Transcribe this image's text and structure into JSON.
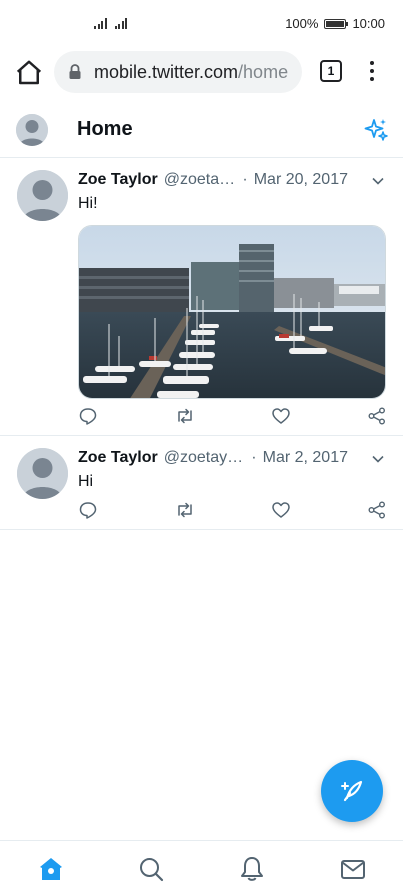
{
  "status_bar": {
    "battery": "100%",
    "time": "10:00"
  },
  "browser": {
    "url_host": "mobile.twitter.com",
    "url_path": "/home",
    "tab_count": "1"
  },
  "header": {
    "title": "Home"
  },
  "tweets": [
    {
      "name": "Zoe Taylor",
      "handle": "@zoetaylo...",
      "separator": "·",
      "date": "Mar 20, 2017",
      "text": "Hi!",
      "has_media": true
    },
    {
      "name": "Zoe Taylor",
      "handle": "@zoetaylor...",
      "separator": "·",
      "date": "Mar 2, 2017",
      "text": "Hi",
      "has_media": false
    }
  ],
  "colors": {
    "accent": "#1d9bf0",
    "text": "#0f1419",
    "secondary_text": "#536471",
    "divider": "#e6ecf0"
  },
  "icons": {
    "browser": [
      "home-icon",
      "lock-icon",
      "tabs-icon",
      "more-vert-icon"
    ],
    "header": [
      "sparkle-icon"
    ],
    "tweet_actions": [
      "reply-icon",
      "retweet-icon",
      "like-icon",
      "share-icon"
    ],
    "fab": "compose-tweet-icon",
    "bottom_nav": [
      "home-icon",
      "search-icon",
      "notifications-icon",
      "messages-icon"
    ]
  }
}
